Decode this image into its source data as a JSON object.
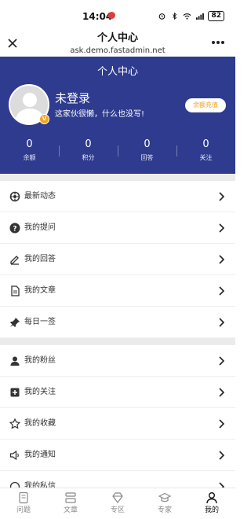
{
  "status_bar": {
    "time": "14:04",
    "battery": "82"
  },
  "nav": {
    "title": "个人中心",
    "subtitle": "ask.demo.fastadmin.net"
  },
  "profile": {
    "title": "个人中心",
    "username": "未登录",
    "bio": "这家伙很懒，什么也没写!",
    "vip_badge": "V",
    "recharge_label": "余额充值",
    "stats": [
      {
        "value": "0",
        "label": "余额"
      },
      {
        "value": "0",
        "label": "积分"
      },
      {
        "value": "0",
        "label": "回答"
      },
      {
        "value": "0",
        "label": "关注"
      }
    ]
  },
  "menu_group_1": [
    {
      "label": "最新动态",
      "icon": "activity-icon"
    },
    {
      "label": "我的提问",
      "icon": "question-icon"
    },
    {
      "label": "我的回答",
      "icon": "pencil-icon"
    },
    {
      "label": "我的文章",
      "icon": "document-icon"
    },
    {
      "label": "每日一签",
      "icon": "pin-icon"
    }
  ],
  "menu_group_2": [
    {
      "label": "我的粉丝",
      "icon": "user-icon"
    },
    {
      "label": "我的关注",
      "icon": "plus-square-icon"
    },
    {
      "label": "我的收藏",
      "icon": "star-icon"
    },
    {
      "label": "我的通知",
      "icon": "speaker-icon"
    },
    {
      "label": "我的私信",
      "icon": "message-icon"
    }
  ],
  "tabs": [
    {
      "label": "问题",
      "icon": "question-tab-icon"
    },
    {
      "label": "文章",
      "icon": "article-tab-icon"
    },
    {
      "label": "专区",
      "icon": "zone-tab-icon"
    },
    {
      "label": "专家",
      "icon": "expert-tab-icon"
    },
    {
      "label": "我的",
      "icon": "me-tab-icon",
      "active": true
    }
  ],
  "colors": {
    "header_bg": "#2e3b8e",
    "accent": "#f5a623"
  }
}
